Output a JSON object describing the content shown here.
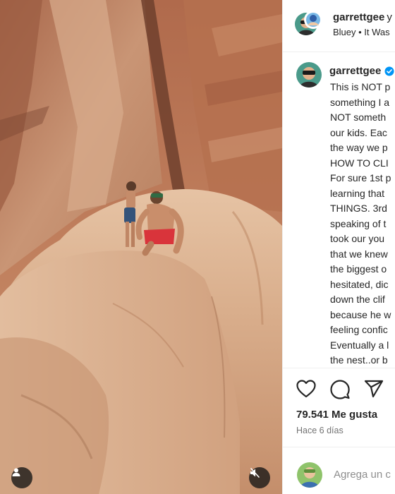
{
  "header": {
    "username": "garrettgee",
    "separator": "y",
    "music": "Bluey • It Was"
  },
  "caption": {
    "username": "garrettgee",
    "verified": true,
    "lines": [
      "This is NOT p",
      "something I a",
      "NOT someth",
      "our kids. Eac",
      "the way we p",
      "HOW TO CLI",
      "For sure 1st p",
      "learning that",
      "THINGS. 3rd",
      "speaking of t",
      "took our you",
      "that we knew",
      "the biggest o",
      "hesitated, dic",
      "down the clif",
      "because he w",
      "feeling confic",
      "Eventually a l",
      "the nest..or b"
    ]
  },
  "actions": {
    "like_icon": "heart-icon",
    "comment_icon": "comment-icon",
    "share_icon": "paper-plane-icon"
  },
  "likes": "79.541 Me gusta",
  "timestamp": "Hace 6 días",
  "comment": {
    "placeholder": "Agrega un c"
  },
  "media": {
    "tag_icon": "user-tag-icon",
    "mute_icon": "muted-speaker-icon"
  },
  "colors": {
    "verified": "#0095f6",
    "text": "#262626",
    "muted": "#737373"
  }
}
